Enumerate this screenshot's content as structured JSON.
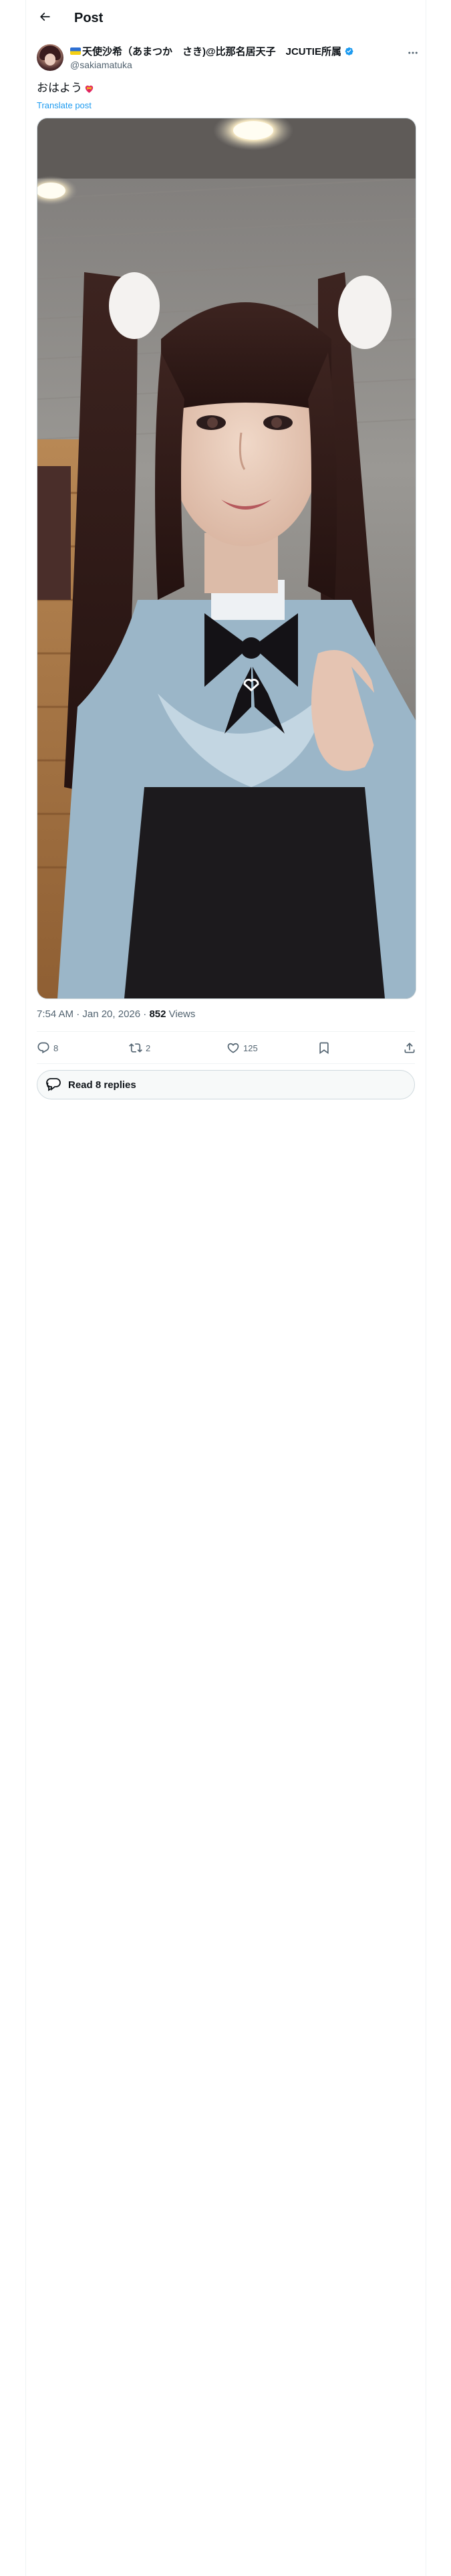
{
  "header": {
    "title": "Post",
    "back_icon": "back-arrow-icon"
  },
  "post": {
    "author": {
      "display_name": "天使沙希（あまつか　さき)@比那名居天子　JCUTIE所属",
      "handle": "@sakiamatuka",
      "verified": true,
      "flag_icon": "flag-icon"
    },
    "text": "おはよう",
    "text_emoji": "heart-with-ribbon-icon",
    "translate_label": "Translate post",
    "timestamp": "7:54 AM · Jan 20, 2026 · ",
    "views_count": "852",
    "views_label": " Views",
    "media_alt": "photo"
  },
  "actions": {
    "replies": "8",
    "reposts": "2",
    "likes": "125"
  },
  "read_replies": {
    "label": "Read 8 replies"
  },
  "colors": {
    "accent": "#1d9bf0",
    "text": "#0f1419",
    "secondary_text": "#536471",
    "border": "#cfd9de",
    "divider": "#eff3f4",
    "pill_bg": "#f7f9f9"
  }
}
